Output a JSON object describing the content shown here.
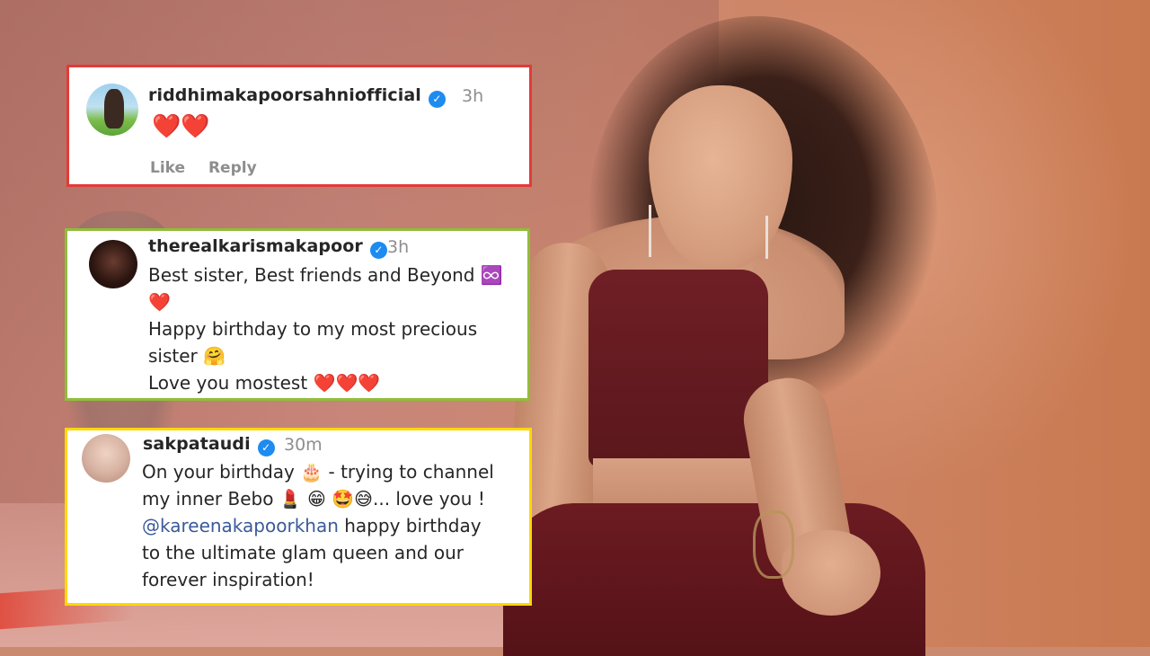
{
  "comments": [
    {
      "username": "riddhimakapoorsahniofficial",
      "time": "3h",
      "text": "❤️❤️",
      "like_label": "Like",
      "reply_label": "Reply"
    },
    {
      "username": "therealkarismakapoor",
      "time": "3h",
      "lines": [
        "Best sister, Best friends and Beyond ♾️",
        "❤️",
        "Happy birthday to my most precious",
        "sister 🤗",
        "Love you mostest ❤️❤️❤️"
      ]
    },
    {
      "username": "sakpataudi",
      "time": "30m",
      "lines": [
        "On your birthday 🎂 - trying to channel",
        "my inner Bebo 💄 😁 🤩😅... love you !",
        "happy birthday",
        "to the ultimate glam queen and our",
        "forever inspiration!"
      ],
      "mention": "@kareenakapoorkhan"
    }
  ],
  "colors": {
    "card1_border": "#e23b39",
    "card2_border": "#8fbe3a",
    "card3_border": "#ffd800",
    "verified": "#1d8bf0",
    "heart": "#e0102a"
  },
  "icons": [
    "verified-badge-icon",
    "heart-icon"
  ]
}
